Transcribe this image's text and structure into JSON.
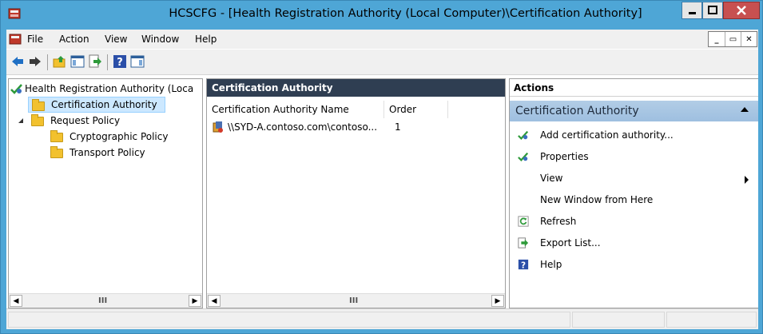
{
  "window": {
    "title": "HCSCFG - [Health Registration Authority (Local Computer)\\Certification Authority]",
    "accent_color": "#4ea6d6"
  },
  "menu": {
    "items": [
      "File",
      "Action",
      "View",
      "Window",
      "Help"
    ]
  },
  "toolbar": {
    "icons": [
      "back-arrow-icon",
      "forward-arrow-icon",
      "up-folder-icon",
      "show-hide-tree-icon",
      "export-list-icon",
      "help-icon",
      "show-hide-action-pane-icon"
    ]
  },
  "tree": {
    "root": "Health Registration Authority (Loca",
    "items": [
      {
        "label": "Certification Authority",
        "selected": true
      },
      {
        "label": "Request Policy",
        "expanded": true
      },
      {
        "label": "Cryptographic Policy"
      },
      {
        "label": "Transport Policy"
      }
    ]
  },
  "list": {
    "header": "Certification Authority",
    "columns": [
      "Certification Authority Name",
      "Order"
    ],
    "rows": [
      {
        "name": "\\\\SYD-A.contoso.com\\contoso...",
        "order": "1"
      }
    ]
  },
  "actions": {
    "header": "Actions",
    "section": "Certification Authority",
    "items": [
      {
        "label": "Add certification authority...",
        "icon": "add-ca-icon"
      },
      {
        "label": "Properties",
        "icon": "properties-icon"
      },
      {
        "label": "View",
        "icon": "",
        "submenu": true
      },
      {
        "label": "New Window from Here",
        "icon": ""
      },
      {
        "label": "Refresh",
        "icon": "refresh-icon"
      },
      {
        "label": "Export List...",
        "icon": "export-list-icon"
      },
      {
        "label": "Help",
        "icon": "help-icon"
      }
    ]
  },
  "scroll": {
    "thumb": "III"
  }
}
